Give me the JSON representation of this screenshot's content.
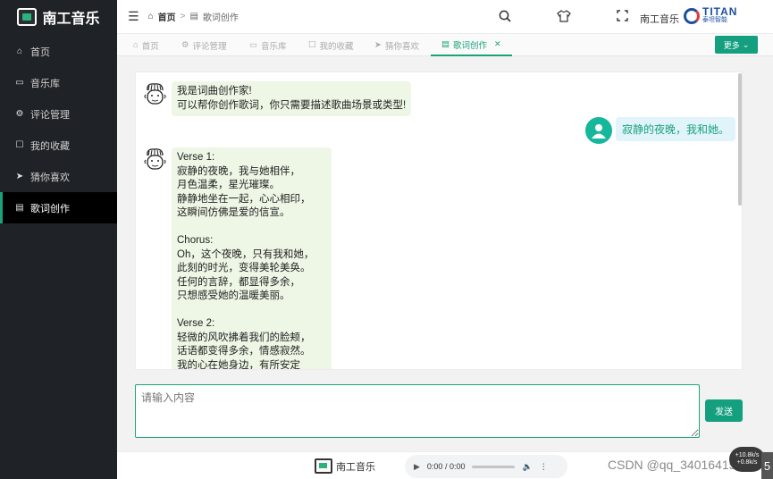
{
  "app": {
    "name": "南工音乐"
  },
  "sidebar": {
    "items": [
      {
        "label": "首页",
        "icon": "home-icon"
      },
      {
        "label": "音乐库",
        "icon": "monitor-icon"
      },
      {
        "label": "评论管理",
        "icon": "gear-icon"
      },
      {
        "label": "我的收藏",
        "icon": "bookmark-icon"
      },
      {
        "label": "猜你喜欢",
        "icon": "send-icon"
      },
      {
        "label": "歌词创作",
        "icon": "document-icon",
        "active": true
      }
    ]
  },
  "header": {
    "breadcrumb": [
      "首页",
      "歌词创作"
    ],
    "user_name": "南工音乐",
    "partner_logo": {
      "text": "TITAN",
      "sub": "泰坦智能"
    }
  },
  "tabs": [
    {
      "label": "首页",
      "icon": "home-icon"
    },
    {
      "label": "评论管理",
      "icon": "gear-icon"
    },
    {
      "label": "音乐库",
      "icon": "monitor-icon"
    },
    {
      "label": "我的收藏",
      "icon": "bookmark-icon"
    },
    {
      "label": "猜你喜欢",
      "icon": "send-icon"
    },
    {
      "label": "歌词创作",
      "icon": "document-icon",
      "active": true,
      "closable": true
    }
  ],
  "more_button": "更多",
  "chat": {
    "messages": [
      {
        "role": "bot",
        "text": "我是词曲创作家!\n可以帮你创作歌词，你只需要描述歌曲场景或类型!"
      },
      {
        "role": "user",
        "text": "寂静的夜晚，我和她。"
      },
      {
        "role": "bot",
        "text": "Verse 1:\n寂静的夜晚，我与她相伴，\n月色温柔，星光璀璨。\n静静地坐在一起，心心相印，\n这瞬间仿佛是爱的信宣。\n\nChorus:\nOh，这个夜晚，只有我和她，\n此刻的时光，变得美轮美奂。\n任何的言辞，都显得多余，\n只想感受她的温暖美丽。\n\nVerse 2:\n轻微的风吹拂着我们的脸颊，\n话语都变得多余，情感寂然。\n我的心在她身边，有所安定"
      }
    ]
  },
  "input": {
    "placeholder": "请输入内容"
  },
  "send_button": "发送",
  "player": {
    "brand": "南工音乐",
    "time": "0:00 / 0:00"
  },
  "overlay": {
    "watermark": "CSDN @qq_34016415",
    "speed_badge": [
      "+10.8k/s",
      "+0.8k/s"
    ],
    "side_number": "5"
  },
  "colors": {
    "accent": "#149f7f",
    "sidebar_bg": "#1f2226",
    "bot_bubble": "#eef7e6",
    "user_bubble": "#e1f3fb"
  }
}
